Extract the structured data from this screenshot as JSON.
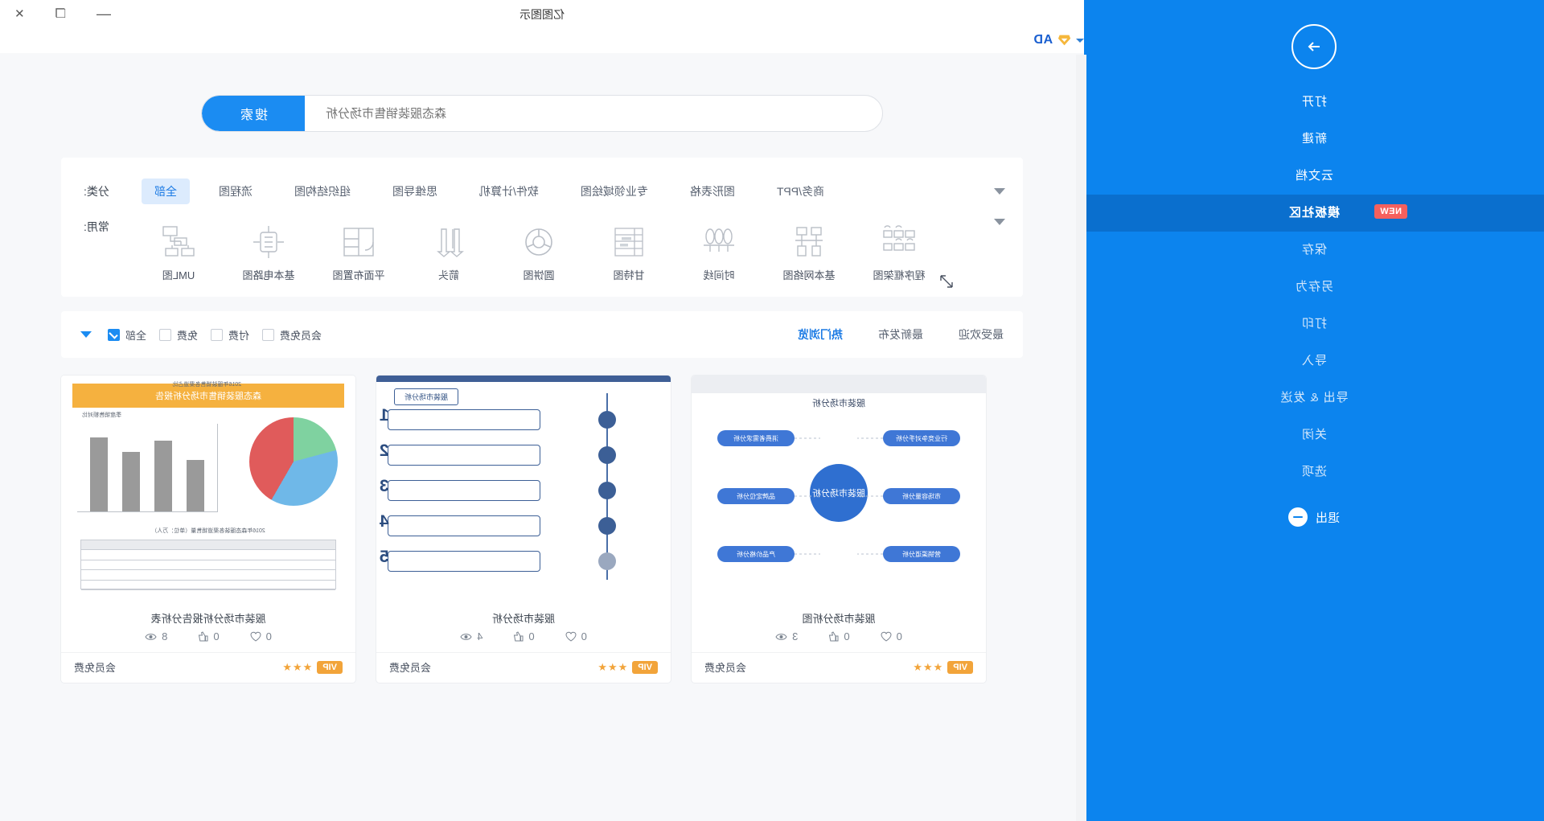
{
  "window": {
    "title": "亿图图示",
    "controls": {
      "minimize": "—",
      "restore": "❐",
      "close": "✕"
    },
    "ad_label": "AD"
  },
  "sidebar": {
    "back_icon": "arrow-right-icon",
    "items": [
      {
        "label": "打开",
        "active": false,
        "dim": false,
        "badge": ""
      },
      {
        "label": "新建",
        "active": false,
        "dim": false,
        "badge": ""
      },
      {
        "label": "云文档",
        "active": false,
        "dim": false,
        "badge": ""
      },
      {
        "label": "模板社区",
        "active": true,
        "dim": false,
        "badge": "NEW"
      },
      {
        "label": "保存",
        "active": false,
        "dim": true,
        "badge": ""
      },
      {
        "label": "另存为",
        "active": false,
        "dim": true,
        "badge": ""
      },
      {
        "label": "打印",
        "active": false,
        "dim": true,
        "badge": ""
      },
      {
        "label": "导入",
        "active": false,
        "dim": true,
        "badge": ""
      },
      {
        "label": "导出 & 发送",
        "active": false,
        "dim": true,
        "badge": ""
      },
      {
        "label": "关闭",
        "active": false,
        "dim": true,
        "badge": ""
      },
      {
        "label": "选项",
        "active": false,
        "dim": true,
        "badge": ""
      }
    ],
    "exit": {
      "label": "退出",
      "icon": "minus-circle-icon"
    }
  },
  "search": {
    "placeholder": "森态服装销售市场分析",
    "value": "",
    "button_label": "搜索"
  },
  "categories": {
    "label": "分类:",
    "items": [
      {
        "label": "全部",
        "selected": true
      },
      {
        "label": "流程图",
        "selected": false
      },
      {
        "label": "组织结构图",
        "selected": false
      },
      {
        "label": "思维导图",
        "selected": false
      },
      {
        "label": "软件/计算机",
        "selected": false
      },
      {
        "label": "专业领域绘图",
        "selected": false
      },
      {
        "label": "图形表格",
        "selected": false
      },
      {
        "label": "商务/PPT",
        "selected": false
      }
    ],
    "expand_icon": "chevron-down-icon"
  },
  "common": {
    "label": "常用:",
    "items": [
      {
        "label": "UML图",
        "icon": "uml-diagram-icon"
      },
      {
        "label": "基本电路图",
        "icon": "circuit-diagram-icon"
      },
      {
        "label": "平面布置图",
        "icon": "floorplan-icon"
      },
      {
        "label": "箭头",
        "icon": "arrow-shapes-icon"
      },
      {
        "label": "圆饼图",
        "icon": "pie-chart-icon"
      },
      {
        "label": "甘特图",
        "icon": "gantt-chart-icon"
      },
      {
        "label": "时间线",
        "icon": "timeline-icon"
      },
      {
        "label": "基本网络图",
        "icon": "network-diagram-icon"
      },
      {
        "label": "程序框架图",
        "icon": "program-framework-icon"
      }
    ],
    "expand_icon": "chevron-down-icon",
    "resize_icon": "expand-arrows-icon"
  },
  "sortbar": {
    "tabs": [
      {
        "label": "热门浏览",
        "active": true
      },
      {
        "label": "最新发布",
        "active": false
      },
      {
        "label": "最受欢迎",
        "active": false
      }
    ],
    "filter_caret": "chevron-down-icon",
    "checks": [
      {
        "label": "全部",
        "checked": true
      },
      {
        "label": "免费",
        "checked": false
      },
      {
        "label": "付费",
        "checked": false
      },
      {
        "label": "会员免费",
        "checked": false
      }
    ]
  },
  "cards": [
    {
      "title": "服装市场分析报告分析表",
      "thumb_kind": "report",
      "thumb_title": "森态服装销售市场分析报告",
      "chart": {
        "pie_legend": [
          "2016年服装销售各渠道占比"
        ],
        "bar_title": "季度销售额对比",
        "table_title": "2016年森态服装各渠道销售量（单位：万人）"
      },
      "views": "8",
      "likes": "0",
      "favorites": "0",
      "price_label": "会员免费",
      "tag": "VIP",
      "stars": "★★★"
    },
    {
      "title": "服装市场分析",
      "thumb_kind": "timeline",
      "thumb_title": "服装市场分析",
      "steps": [
        "1",
        "2",
        "3",
        "4",
        "5"
      ],
      "views": "4",
      "likes": "0",
      "favorites": "0",
      "price_label": "会员免费",
      "tag": "VIP",
      "stars": "★★★"
    },
    {
      "title": "服装市场分析图",
      "thumb_kind": "mindmap",
      "thumb_title": "服装市场分析",
      "center": "服装市场分析",
      "nodes": [
        "行业竞争对手分析",
        "消费者需求分析",
        "市场容量分析",
        "品牌定位分析",
        "营销渠道分析",
        "产品价格分析"
      ],
      "views": "3",
      "likes": "0",
      "favorites": "0",
      "price_label": "会员免费",
      "tag": "VIP",
      "stars": "★★★"
    }
  ],
  "icons": {
    "eye": "eye-icon",
    "thumb": "thumbs-up-icon",
    "heart": "heart-icon"
  },
  "colors": {
    "brand_blue": "#0c84ee",
    "accent_blue": "#1b8cf2",
    "badge_red": "#f5605d",
    "vip_orange": "#f2a43a"
  }
}
